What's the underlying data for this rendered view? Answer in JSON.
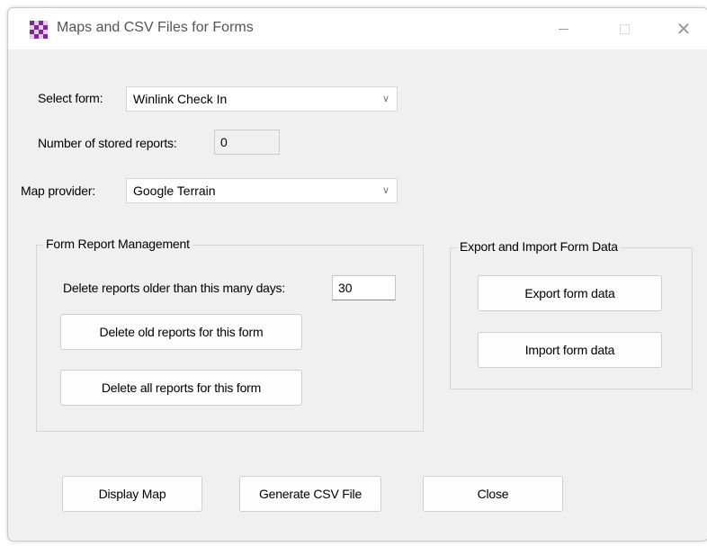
{
  "window": {
    "title": "Maps and CSV Files for Forms",
    "minimize_glyph": "—",
    "close_glyph": "✕",
    "icon": "checkerboard-app-icon"
  },
  "form_select": {
    "label": "Select form:",
    "value": "Winlink Check In"
  },
  "stored_reports": {
    "label": "Number of stored reports:",
    "value": "0"
  },
  "map_provider": {
    "label": "Map provider:",
    "value": "Google Terrain"
  },
  "report_management": {
    "title": "Form Report Management",
    "days_label": "Delete reports older than this many days:",
    "days_value": "30",
    "delete_old_label": "Delete old reports for this form",
    "delete_all_label": "Delete all reports for this form"
  },
  "export_import": {
    "title": "Export and Import Form Data",
    "export_label": "Export form data",
    "import_label": "Import form data"
  },
  "footer": {
    "display_map_label": "Display Map",
    "generate_csv_label": "Generate CSV File",
    "close_label": "Close"
  },
  "colors": {
    "window_bg": "#f0f0f0",
    "icon_primary": "#7b2a8e",
    "icon_secondary": "#e8c8ee"
  }
}
